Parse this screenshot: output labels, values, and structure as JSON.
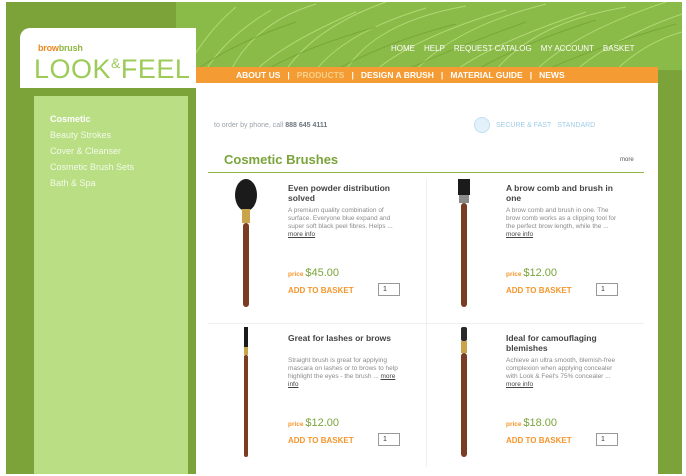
{
  "logo": {
    "brand_part1": "brow",
    "brand_part2": "brush",
    "main_left": "LOOK",
    "amp": "&",
    "main_right": "FEEL"
  },
  "top_nav": [
    "HOME",
    "HELP",
    "REQUEST CATALOG",
    "MY ACCOUNT",
    "BASKET"
  ],
  "main_nav": {
    "items": [
      "ABOUT US",
      "PRODUCTS",
      "DESIGN A BRUSH",
      "MATERIAL GUIDE",
      "NEWS"
    ],
    "active": "PRODUCTS",
    "separator": "|"
  },
  "sidebar": {
    "items": [
      "Cosmetic",
      "Beauty Strokes",
      "Cover & Cleanser",
      "Cosmetic Brush Sets",
      "Bath & Spa"
    ],
    "active": "Cosmetic"
  },
  "contact": {
    "prefix": "to order by phone, call",
    "number": "888 645 4111"
  },
  "badge": {
    "left": "SECURE & FAST",
    "right": "STANDARD"
  },
  "category": {
    "title": "Cosmetic Brushes",
    "link": "more"
  },
  "products": [
    {
      "title": "Even powder distribution solved",
      "desc": "A premium quality combination of surface. Everyone blue expand and super soft black peel fibres. Helps ...",
      "more": "more info",
      "price_label": "price",
      "price": "$45.00",
      "add": "ADD TO BASKET",
      "qty": "1"
    },
    {
      "title": "A brow comb and brush in one",
      "desc": "A brow comb and brush in one. The brow comb works as a clipping tool for the perfect brow length, while the ...",
      "more": "more info",
      "price_label": "price",
      "price": "$12.00",
      "add": "ADD TO BASKET",
      "qty": "1"
    },
    {
      "title": "Great for lashes or brows",
      "desc": "Straight brush is great for applying mascara on lashes or to brows to help highlight the eyes - the brush ...",
      "more": "more info",
      "price_label": "price",
      "price": "$12.00",
      "add": "ADD TO BASKET",
      "qty": "1"
    },
    {
      "title": "Ideal for camouflaging blemishes",
      "desc": "Achieve an ultra smooth, blemish-free complexion when applying concealer with Look & Feel's 75% concealer ...",
      "more": "more info",
      "price_label": "price",
      "price": "$18.00",
      "add": "ADD TO BASKET",
      "qty": "1"
    }
  ],
  "colors": {
    "frame_green": "#7ba33a",
    "nav_orange": "#f59b33",
    "sidebar_green": "#b9de84",
    "title_green": "#7aa43a",
    "price_orange": "#f5962c"
  }
}
